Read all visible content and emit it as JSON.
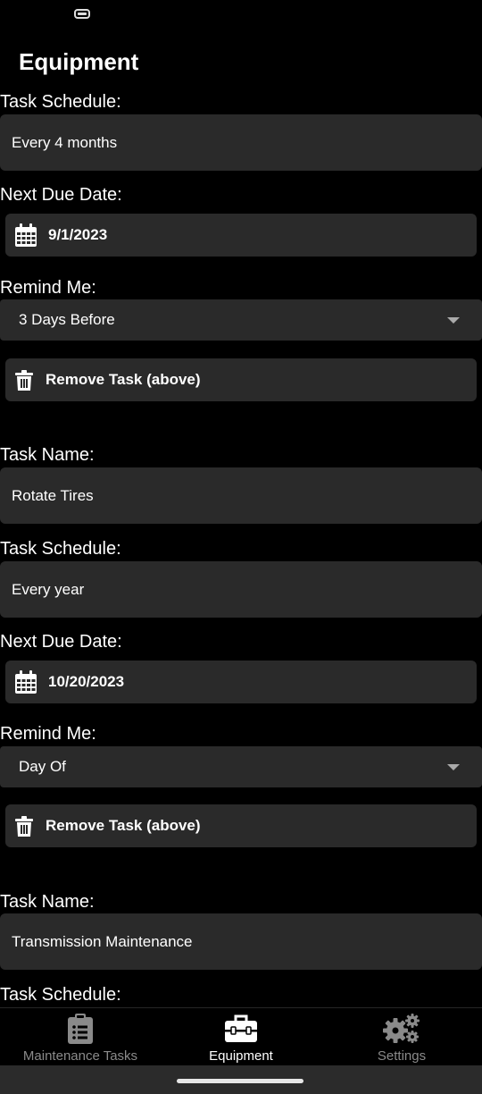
{
  "header": {
    "title": "Equipment"
  },
  "labels": {
    "task_name": "Task Name:",
    "task_schedule": "Task Schedule:",
    "next_due_date": "Next Due Date:",
    "remind_me": "Remind Me:",
    "remove_task": "Remove Task (above)"
  },
  "tasks": [
    {
      "schedule": "Every 4 months",
      "due_date": "9/1/2023",
      "remind": "3 Days Before"
    },
    {
      "name": "Rotate Tires",
      "schedule": "Every year",
      "due_date": "10/20/2023",
      "remind": "Day Of"
    },
    {
      "name": "Transmission Maintenance"
    }
  ],
  "tabs": [
    {
      "label": "Maintenance Tasks",
      "icon": "clipboard-list-icon",
      "active": false
    },
    {
      "label": "Equipment",
      "icon": "toolbox-icon",
      "active": true
    },
    {
      "label": "Settings",
      "icon": "gears-icon",
      "active": false
    }
  ],
  "colors": {
    "background": "#000000",
    "field_bg": "#2a2a2a",
    "text": "#ffffff",
    "inactive_tab": "#8a8a8a"
  }
}
